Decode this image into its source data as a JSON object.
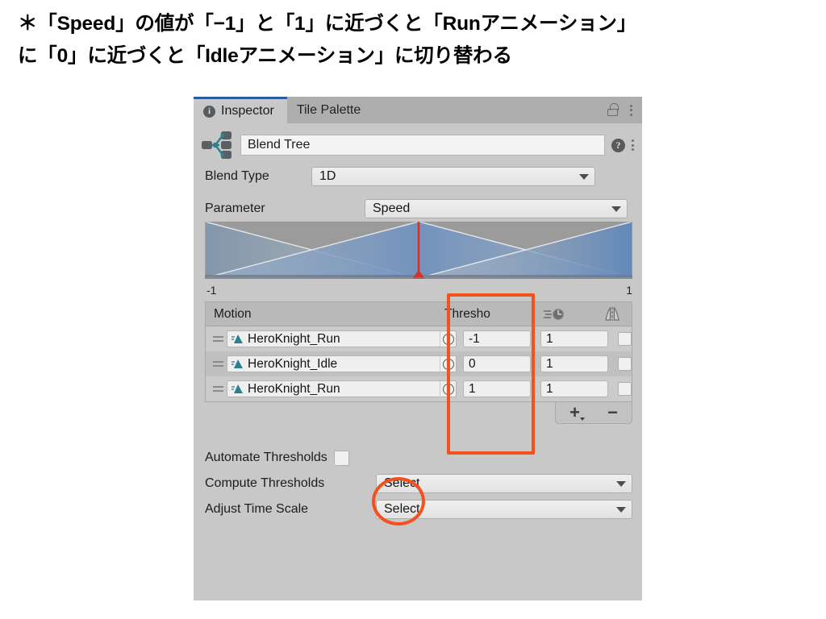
{
  "caption": {
    "line1": "＊「Speed」の値が「−1」と「1」に近づくと「Runアニメーション」",
    "line2": "に「0」に近づくと「Idleアニメーション」に切り替わる"
  },
  "inspector": {
    "tabs": [
      {
        "label": "Inspector",
        "icon": "info-icon",
        "active": true
      },
      {
        "label": "Tile Palette",
        "icon": "",
        "active": false
      }
    ],
    "lock_icon": "lock-open-icon",
    "menu_icon": "kebab-menu-icon",
    "asset": {
      "icon": "blend-tree-icon",
      "name": "Blend Tree",
      "help_icon": "help-icon",
      "menu_icon": "kebab-menu-icon"
    },
    "blend_type": {
      "label": "Blend Type",
      "value": "1D"
    },
    "parameter": {
      "label": "Parameter",
      "value": "Speed"
    },
    "graph": {
      "axis_min": "-1",
      "axis_max": "1",
      "playhead_position_pct": 50,
      "playhead_color": "#d93025"
    },
    "table": {
      "headers": {
        "motion": "Motion",
        "threshold": "Thresho",
        "speed_icon": "speed-clock-icon",
        "mirror_icon": "mirror-icon"
      },
      "rows": [
        {
          "motion": "HeroKnight_Run",
          "threshold": "-1",
          "speed": "1",
          "mirror": false
        },
        {
          "motion": "HeroKnight_Idle",
          "threshold": "0",
          "speed": "1",
          "mirror": false
        },
        {
          "motion": "HeroKnight_Run",
          "threshold": "1",
          "speed": "1",
          "mirror": false
        }
      ],
      "add_label": "+",
      "remove_label": "−"
    },
    "automate_thresholds": {
      "label": "Automate Thresholds",
      "checked": false
    },
    "compute_thresholds": {
      "label": "Compute Thresholds",
      "value": "Select"
    },
    "adjust_time_scale": {
      "label": "Adjust Time Scale",
      "value": "Select"
    }
  },
  "annotations": {
    "threshold_highlight_color": "#f4511e",
    "checkbox_highlight_color": "#f4511e"
  }
}
